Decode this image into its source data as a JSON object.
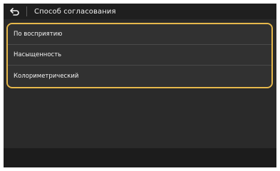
{
  "header": {
    "back_icon": "back-arrow-icon",
    "title": "Способ согласования"
  },
  "options": [
    {
      "label": "По восприятию"
    },
    {
      "label": "Насыщенность"
    },
    {
      "label": "Колориметрический"
    }
  ],
  "colors": {
    "background": "#2a2a2a",
    "titlebar": "#1f1f1f",
    "accent_frame": "#e6b84c",
    "text": "#f2f2f2"
  }
}
